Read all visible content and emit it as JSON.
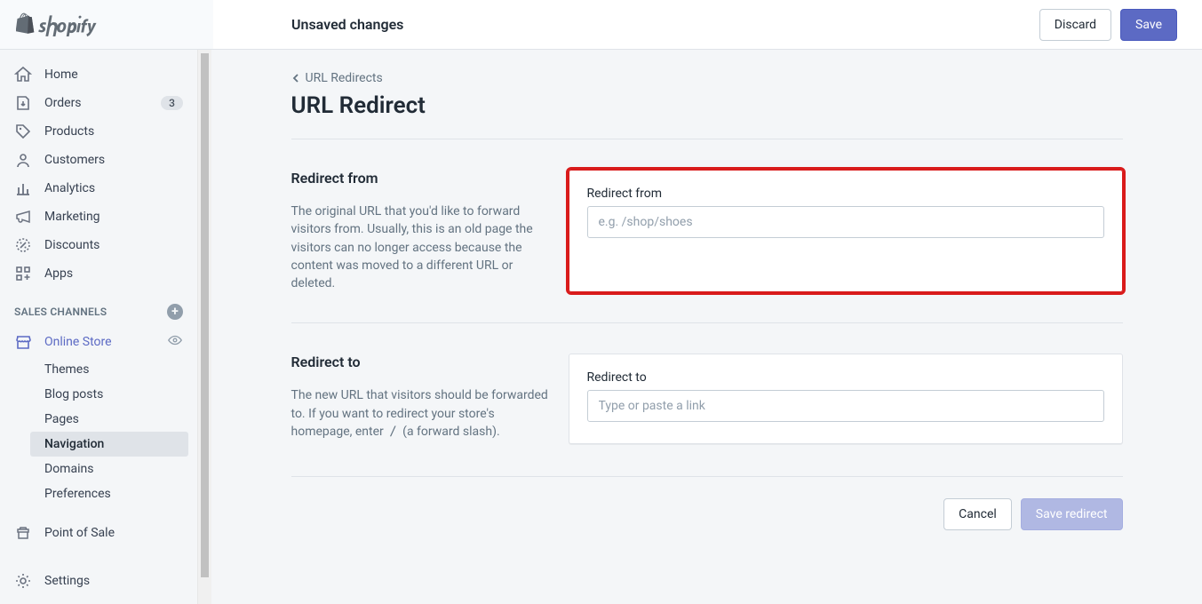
{
  "topbar": {
    "title": "Unsaved changes",
    "discard": "Discard",
    "save": "Save"
  },
  "sidebar": {
    "items": [
      {
        "label": "Home"
      },
      {
        "label": "Orders",
        "badge": "3"
      },
      {
        "label": "Products"
      },
      {
        "label": "Customers"
      },
      {
        "label": "Analytics"
      },
      {
        "label": "Marketing"
      },
      {
        "label": "Discounts"
      },
      {
        "label": "Apps"
      }
    ],
    "sales_channels_label": "SALES CHANNELS",
    "online_store": "Online Store",
    "sub": [
      {
        "label": "Themes"
      },
      {
        "label": "Blog posts"
      },
      {
        "label": "Pages"
      },
      {
        "label": "Navigation"
      },
      {
        "label": "Domains"
      },
      {
        "label": "Preferences"
      }
    ],
    "point_of_sale": "Point of Sale",
    "settings": "Settings"
  },
  "breadcrumb": "URL Redirects",
  "page_title": "URL Redirect",
  "sections": {
    "redirect_from": {
      "title": "Redirect from",
      "help": "The original URL that you'd like to forward visitors from. Usually, this is an old page the visitors can no longer access because the content was moved to a different URL or deleted.",
      "field_label": "Redirect from",
      "placeholder": "e.g. /shop/shoes"
    },
    "redirect_to": {
      "title": "Redirect to",
      "help_before": "The new URL that visitors should be forwarded to. If you want to redirect your store's homepage, enter ",
      "slash": "/",
      "help_after": " (a forward slash).",
      "field_label": "Redirect to",
      "placeholder": "Type or paste a link"
    }
  },
  "footer": {
    "cancel": "Cancel",
    "save_redirect": "Save redirect"
  }
}
